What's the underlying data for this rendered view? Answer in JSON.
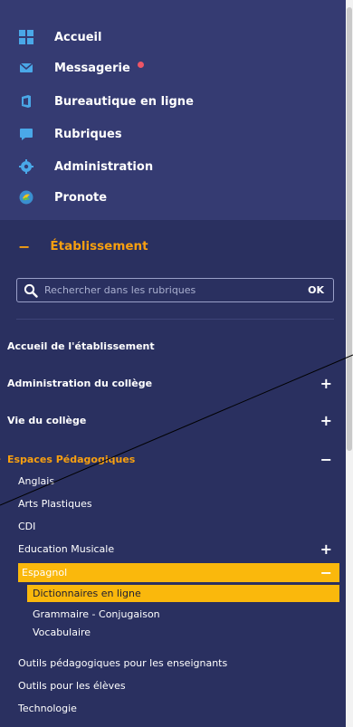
{
  "menu": {
    "items": [
      {
        "label": "Accueil",
        "icon": "grid-icon"
      },
      {
        "label": "Messagerie",
        "icon": "mail-icon",
        "badge": true
      },
      {
        "label": "Bureautique en ligne",
        "icon": "office-icon"
      },
      {
        "label": "Rubriques",
        "icon": "chat-icon"
      },
      {
        "label": "Administration",
        "icon": "gear-icon"
      },
      {
        "label": "Pronote",
        "icon": "pronote-icon"
      }
    ]
  },
  "section": {
    "label": "Établissement",
    "toggle": "−"
  },
  "search": {
    "placeholder": "Rechercher dans les rubriques",
    "value": "",
    "submit": "OK"
  },
  "nav": {
    "accueil": "Accueil de l'établissement",
    "administration": "Administration du collège",
    "vie": "Vie du collège",
    "espaces": "Espaces Pédagogiques",
    "expand": "+",
    "collapse": "−"
  },
  "espaces": {
    "items": [
      "Anglais",
      "Arts Plastiques",
      "CDI",
      "Education Musicale"
    ],
    "active": "Espagnol",
    "children": [
      "Dictionnaires en ligne",
      "Grammaire - Conjugaison",
      "Vocabulaire"
    ],
    "after": [
      "Outils pédagogiques pour les enseignants",
      "Outils pour les élèves",
      "Technologie"
    ]
  },
  "colors": {
    "panel": "#2a3060",
    "menu_bg": "#353b72",
    "accent": "#f8a010",
    "active": "#fab80c",
    "badge": "#ee5566"
  }
}
